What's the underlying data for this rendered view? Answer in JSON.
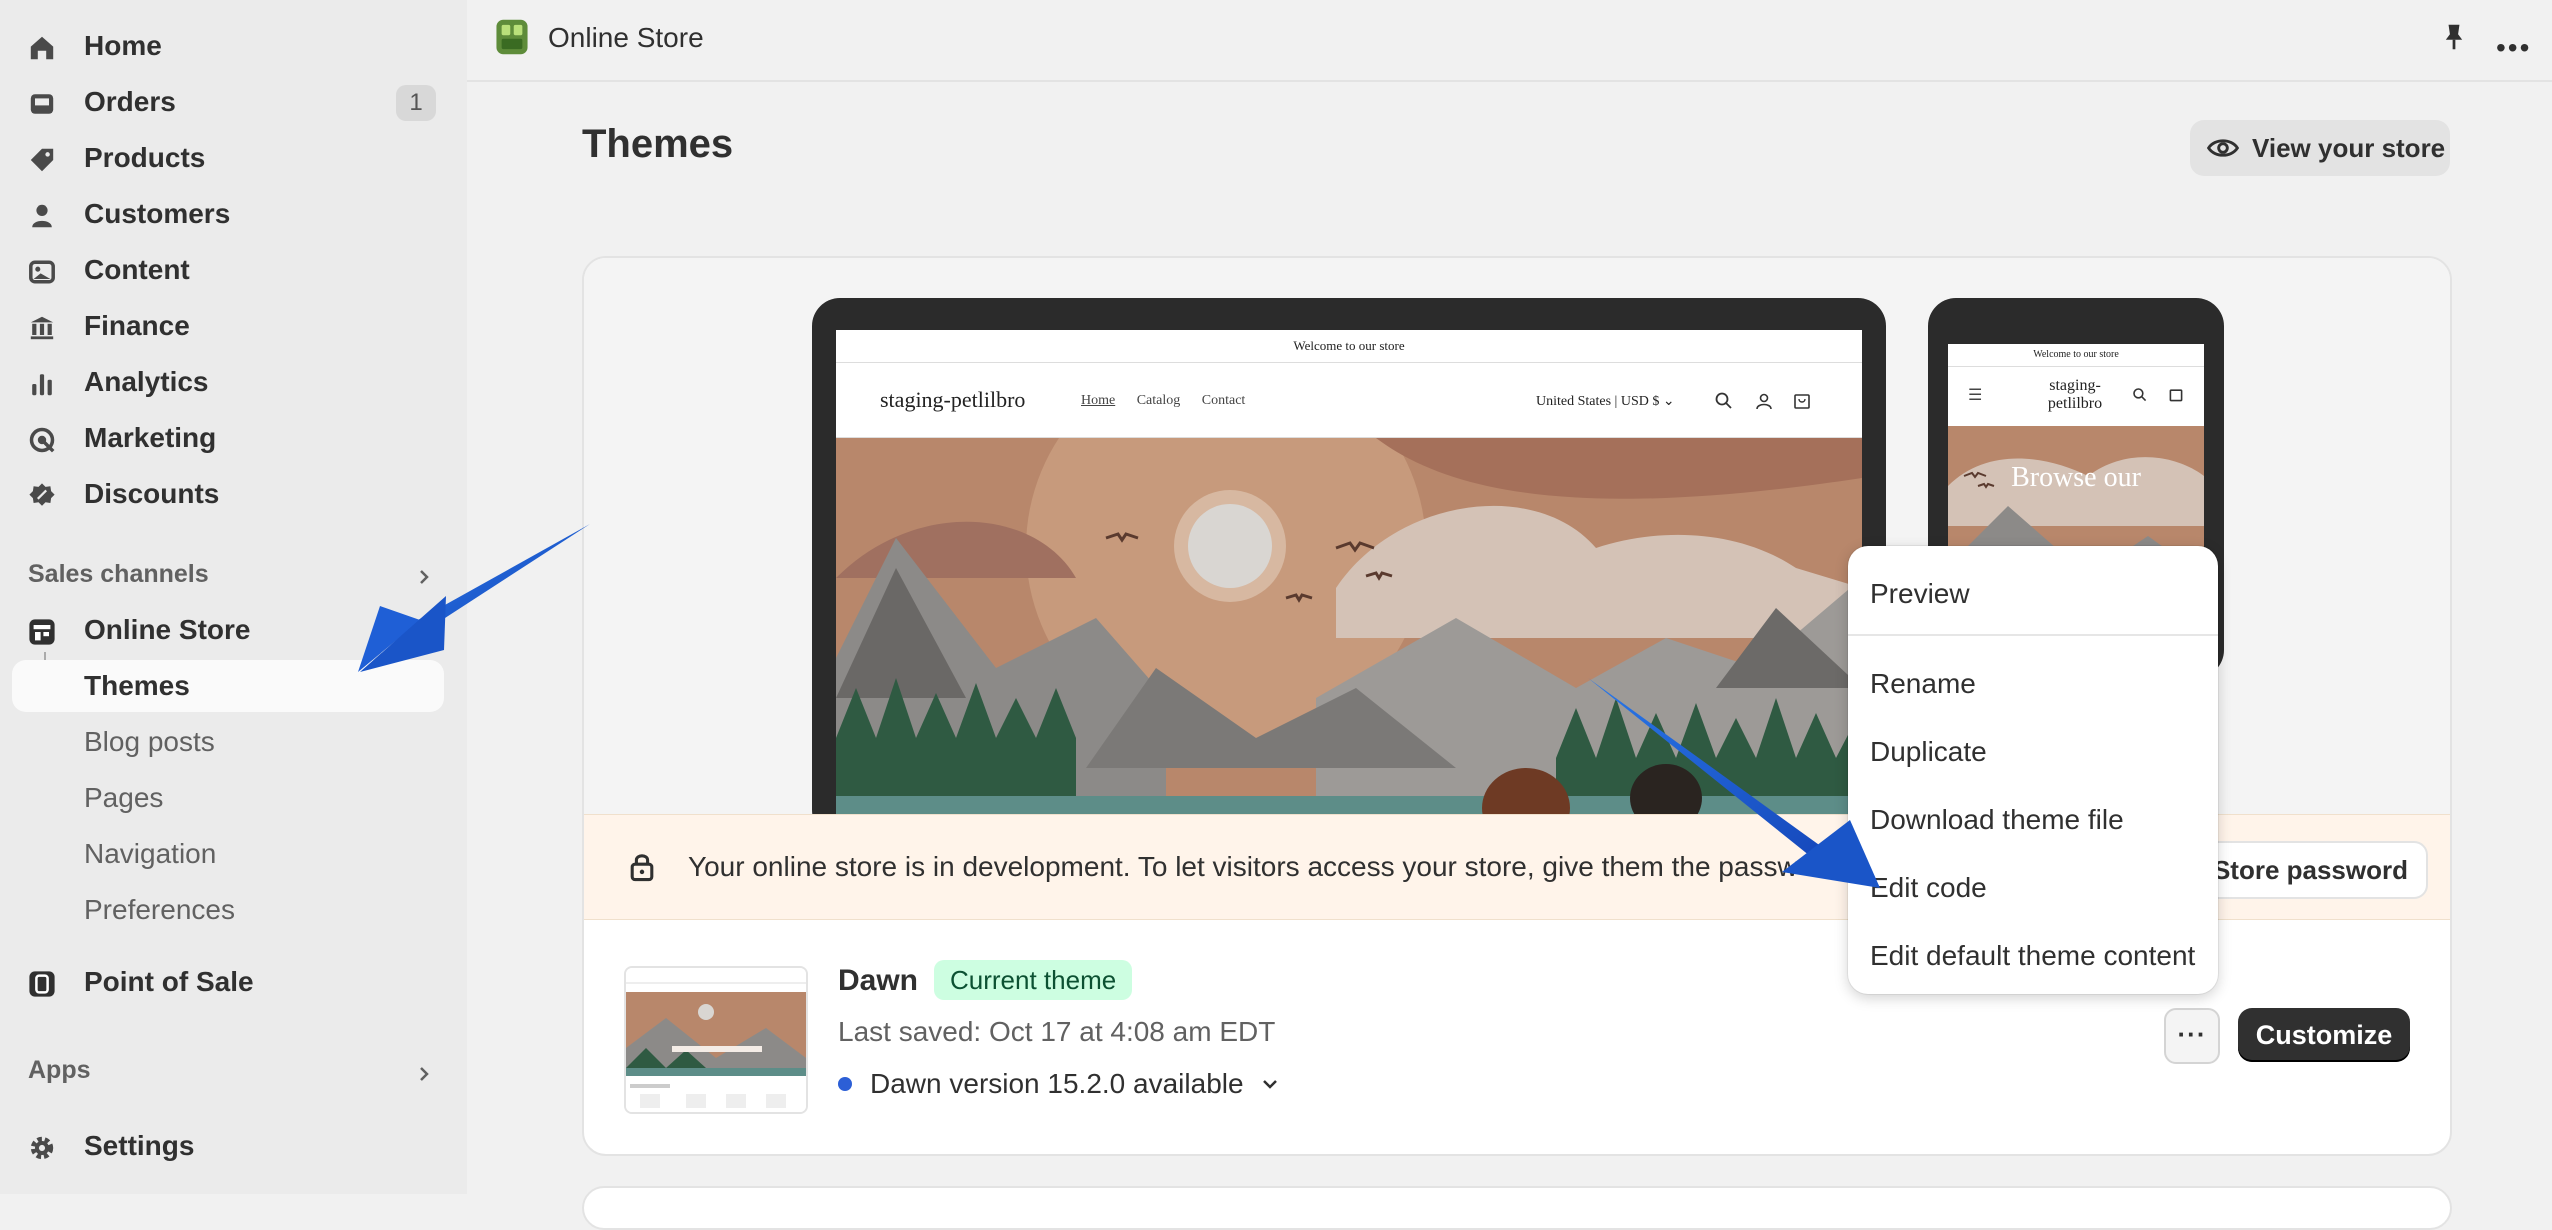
{
  "sidebar": {
    "nav": [
      {
        "label": "Home",
        "icon": "home-icon"
      },
      {
        "label": "Orders",
        "icon": "orders-icon",
        "badge": "1"
      },
      {
        "label": "Products",
        "icon": "tag-icon"
      },
      {
        "label": "Customers",
        "icon": "person-icon"
      },
      {
        "label": "Content",
        "icon": "image-icon"
      },
      {
        "label": "Finance",
        "icon": "bank-icon"
      },
      {
        "label": "Analytics",
        "icon": "bar-chart-icon"
      },
      {
        "label": "Marketing",
        "icon": "target-icon"
      },
      {
        "label": "Discounts",
        "icon": "discount-icon"
      }
    ],
    "sales_channels_heading": "Sales channels",
    "online_store": {
      "label": "Online Store",
      "icon": "store-icon"
    },
    "sub_items": [
      {
        "label": "Themes"
      },
      {
        "label": "Blog posts"
      },
      {
        "label": "Pages"
      },
      {
        "label": "Navigation"
      },
      {
        "label": "Preferences"
      }
    ],
    "point_of_sale": {
      "label": "Point of Sale",
      "icon": "pos-icon"
    },
    "apps_heading": "Apps",
    "settings": {
      "label": "Settings",
      "icon": "gear-icon"
    }
  },
  "header": {
    "title": "Online Store"
  },
  "page": {
    "title": "Themes",
    "view_store_label": "View your store"
  },
  "preview": {
    "announcement": "Welcome to our store",
    "store_name": "staging-petlilbro",
    "nav_links": [
      "Home",
      "Catalog",
      "Contact"
    ],
    "currency": "United States | USD $",
    "phone_store_name": "staging-\npetlilbro",
    "phone_hero_text": "Browse our"
  },
  "banner": {
    "text": "Your online store is in development. To let visitors access your store, give them the passw",
    "button_label": "Store password"
  },
  "theme": {
    "name": "Dawn",
    "badge": "Current theme",
    "last_saved": "Last saved: Oct 17 at 4:08 am EDT",
    "version": "Dawn version 15.2.0 available",
    "more_label": "···",
    "customize_label": "Customize"
  },
  "menu": {
    "items": [
      "Preview",
      "Rename",
      "Duplicate",
      "Download theme file",
      "Edit code",
      "Edit default theme content"
    ]
  },
  "colors": {
    "accent_arrow": "#1f5fd6",
    "badge_green": "#cdfee1",
    "banner_bg": "#fff4ea"
  }
}
